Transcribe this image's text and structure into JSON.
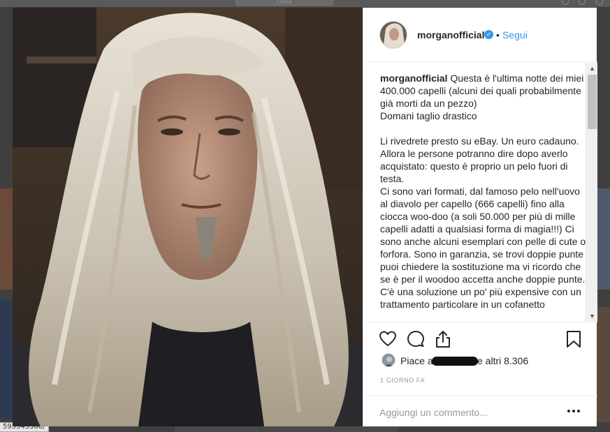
{
  "background": {
    "search_placeholder": "Cerca",
    "url_fragment": "595543300/"
  },
  "post": {
    "author": {
      "username": "morganofficial",
      "verified": true,
      "follow_separator": "•",
      "follow_label": "Segui"
    },
    "caption": {
      "username": "morganofficial",
      "paragraphs": [
        "Questa è l'ultima notte dei miei 400.000 capelli (alcuni dei quali probabilmente già morti da un pezzo)",
        "Domani taglio drastico",
        "Li rivedrete presto su eBay. Un euro cadauno. Allora le persone potranno dire dopo averlo acquistato: questo è proprio un pelo fuori di testa.",
        "Ci sono vari formati, dal famoso pelo nell'uovo al diavolo per capello (666 capelli) fino alla ciocca woo-doo (a soli 50.000 per più di mille capelli adatti a qualsiasi forma di magia!!!) Ci sono anche alcuni esemplari con pelle di cute o forfora. Sono in garanzia, se trovi doppie punte puoi chiedere la sostituzione ma vi ricordo che se è per il woodoo accetta anche doppie punte. C'è una soluzione un po' più expensive con un trattamento particolare in un cofanetto"
      ]
    },
    "actions": {
      "like_icon": "heart-icon",
      "comment_icon": "comment-icon",
      "share_icon": "share-icon",
      "save_icon": "bookmark-icon"
    },
    "likes": {
      "prefix": "Piace a",
      "suffix": "e altri 8.306"
    },
    "timestamp": "1 GIORNO FA",
    "add_comment_placeholder": "Aggiungi un commento...",
    "more_icon": "more-options-icon"
  },
  "colors": {
    "link_blue": "#3897f0",
    "text": "#262626",
    "muted": "#999999",
    "border": "#efefef"
  }
}
